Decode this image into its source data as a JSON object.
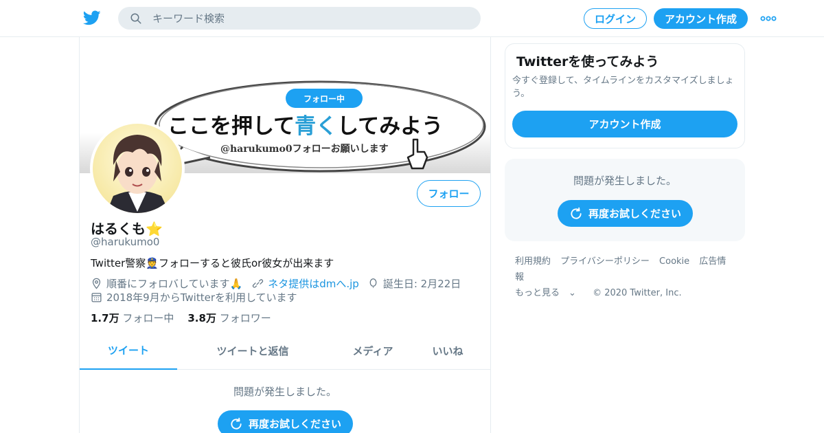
{
  "header": {
    "search_placeholder": "キーワード検索",
    "login_label": "ログイン",
    "signup_label": "アカウント作成"
  },
  "banner": {
    "badge": "フォロー中",
    "headline_part1": "ここを押して",
    "headline_blue": "青く",
    "headline_part2": "してみよう",
    "subline": "@harukumo0フォローお願いします"
  },
  "profile": {
    "follow_label": "フォロー",
    "name": "はるくも",
    "name_emoji": "⭐",
    "handle": "@harukumo0",
    "bio": "Twitter警察👮フォローすると彼氏or彼女が出来ます",
    "location": "順番にフォロバしています🙏",
    "url": "ネタ提供はdmへ.jp",
    "birthday": "誕生日: 2月22日",
    "joined": "2018年9月からTwitterを利用しています",
    "following_count": "1.7万",
    "following_label": "フォロー中",
    "followers_count": "3.8万",
    "followers_label": "フォロワー"
  },
  "tabs": [
    {
      "label": "ツイート",
      "active": true
    },
    {
      "label": "ツイートと返信",
      "active": false
    },
    {
      "label": "メディア",
      "active": false
    },
    {
      "label": "いいね",
      "active": false
    }
  ],
  "timeline": {
    "error_text": "問題が発生しました。",
    "retry_label": "再度お試しください"
  },
  "sidebar": {
    "card_title": "Twitterを使ってみよう",
    "card_text": "今すぐ登録して、タイムラインをカスタマイズしましょう。",
    "card_button": "アカウント作成",
    "error_text": "問題が発生しました。",
    "retry_label": "再度お試しください"
  },
  "footer": {
    "links": [
      "利用規約",
      "プライバシーポリシー",
      "Cookie",
      "広告情報"
    ],
    "more_label": "もっと見る",
    "copyright": "© 2020 Twitter, Inc."
  },
  "colors": {
    "accent": "#1da1f2",
    "text_secondary": "#657786",
    "border": "#e6ecf0"
  }
}
